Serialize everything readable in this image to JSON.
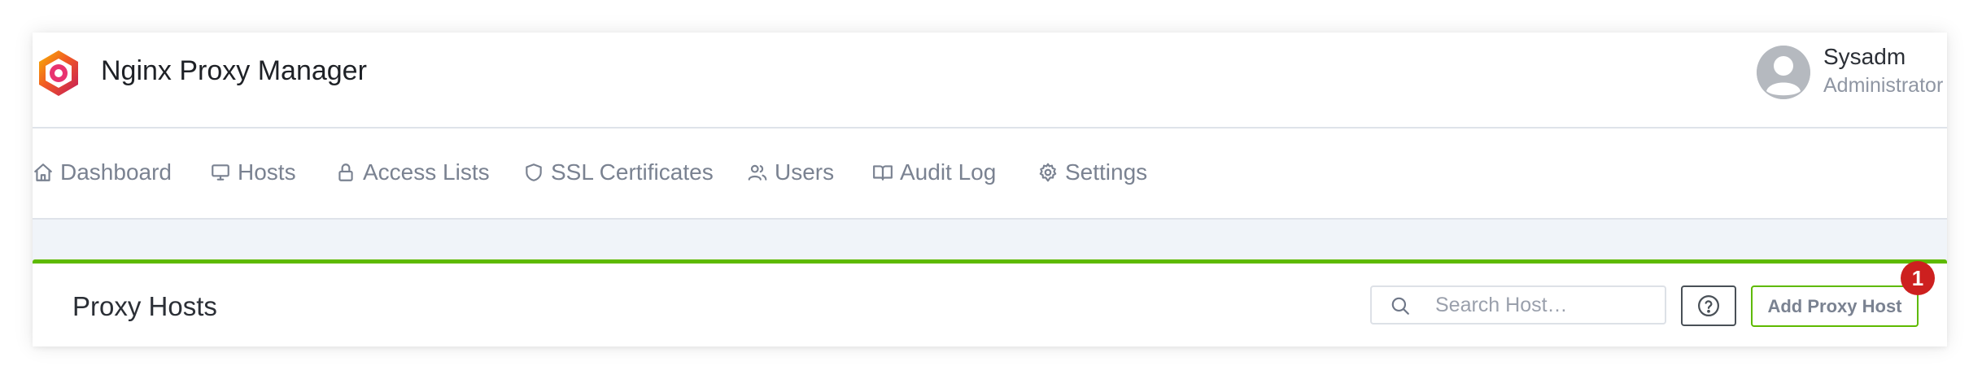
{
  "header": {
    "app_title": "Nginx Proxy Manager",
    "user": {
      "name": "Sysadm",
      "role": "Administrator"
    }
  },
  "nav": {
    "items": [
      {
        "label": "Dashboard",
        "icon": "home-icon"
      },
      {
        "label": "Hosts",
        "icon": "monitor-icon"
      },
      {
        "label": "Access Lists",
        "icon": "lock-icon"
      },
      {
        "label": "SSL Certificates",
        "icon": "shield-icon"
      },
      {
        "label": "Users",
        "icon": "users-icon"
      },
      {
        "label": "Audit Log",
        "icon": "book-icon"
      },
      {
        "label": "Settings",
        "icon": "gear-icon"
      }
    ]
  },
  "card": {
    "title": "Proxy Hosts",
    "search_placeholder": "Search Host…",
    "help_icon": "question-icon",
    "add_label": "Add Proxy Host",
    "badge_count": "1"
  },
  "colors": {
    "accent_green": "#5eba00",
    "badge_red": "#cd201f",
    "nav_text": "#7a8291",
    "content_bg": "#f0f4f9"
  }
}
